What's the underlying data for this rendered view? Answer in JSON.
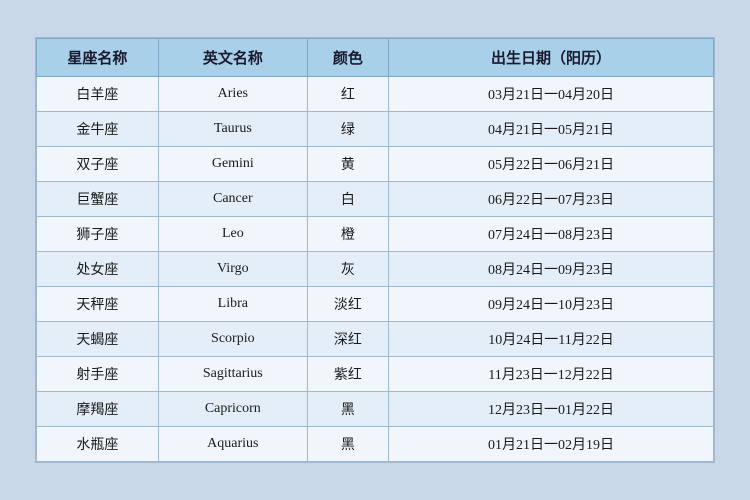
{
  "table": {
    "headers": {
      "chinese_name": "星座名称",
      "english_name": "英文名称",
      "color": "颜色",
      "birth_date": "出生日期（阳历）"
    },
    "rows": [
      {
        "chinese": "白羊座",
        "english": "Aries",
        "color": "红",
        "date": "03月21日一04月20日"
      },
      {
        "chinese": "金牛座",
        "english": "Taurus",
        "color": "绿",
        "date": "04月21日一05月21日"
      },
      {
        "chinese": "双子座",
        "english": "Gemini",
        "color": "黄",
        "date": "05月22日一06月21日"
      },
      {
        "chinese": "巨蟹座",
        "english": "Cancer",
        "color": "白",
        "date": "06月22日一07月23日"
      },
      {
        "chinese": "狮子座",
        "english": "Leo",
        "color": "橙",
        "date": "07月24日一08月23日"
      },
      {
        "chinese": "处女座",
        "english": "Virgo",
        "color": "灰",
        "date": "08月24日一09月23日"
      },
      {
        "chinese": "天秤座",
        "english": "Libra",
        "color": "淡红",
        "date": "09月24日一10月23日"
      },
      {
        "chinese": "天蝎座",
        "english": "Scorpio",
        "color": "深红",
        "date": "10月24日一11月22日"
      },
      {
        "chinese": "射手座",
        "english": "Sagittarius",
        "color": "紫红",
        "date": "11月23日一12月22日"
      },
      {
        "chinese": "摩羯座",
        "english": "Capricorn",
        "color": "黑",
        "date": "12月23日一01月22日"
      },
      {
        "chinese": "水瓶座",
        "english": "Aquarius",
        "color": "黑",
        "date": "01月21日一02月19日"
      }
    ]
  }
}
